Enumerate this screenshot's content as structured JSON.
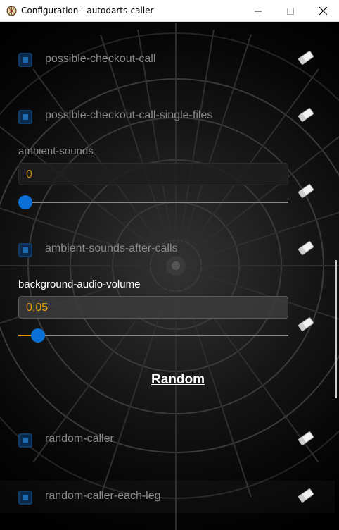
{
  "window": {
    "title": "Configuration - autodarts-caller"
  },
  "settings": {
    "possible_checkout_call": {
      "label": "possible-checkout-call",
      "checked": true
    },
    "possible_checkout_call_single_files": {
      "label": "possible-checkout-call-single-files",
      "checked": true
    },
    "ambient_sounds": {
      "label": "ambient-sounds",
      "value": "0",
      "slider_fraction": 0.0
    },
    "ambient_sounds_after_calls": {
      "label": "ambient-sounds-after-calls",
      "checked": true
    },
    "background_audio_volume": {
      "label": "background-audio-volume",
      "value": "0,05",
      "slider_fraction": 0.05
    }
  },
  "section": {
    "heading": "Random"
  },
  "random": {
    "random_caller": {
      "label": "random-caller",
      "checked": true
    },
    "random_caller_each_leg": {
      "label": "random-caller-each-leg",
      "checked": true
    }
  },
  "colors": {
    "accent_blue": "#0a6fd6",
    "value_orange": "#e0a000",
    "muted_label": "#8a8a8a"
  },
  "icons": {
    "reset": "eraser-icon",
    "app": "dartboard-icon"
  }
}
